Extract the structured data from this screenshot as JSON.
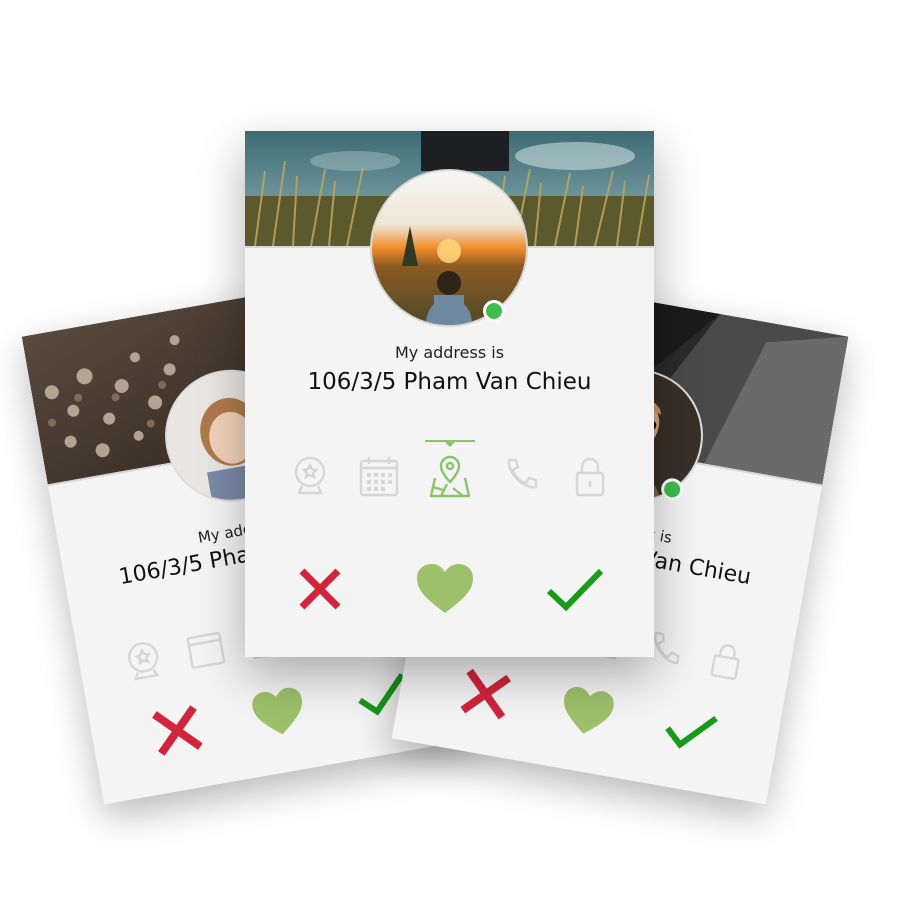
{
  "cards": {
    "left": {
      "subtitle": "My address is",
      "title": "106/3/5 Pham Van Chieu"
    },
    "right": {
      "subtitle": "My address is",
      "title": "106/3/5 Pham Van Chieu"
    },
    "center": {
      "subtitle": "My address is",
      "title": "106/3/5 Pham Van Chieu"
    }
  },
  "tabs": [
    "globe-icon",
    "calendar-icon",
    "map-icon",
    "phone-icon",
    "lock-icon"
  ],
  "active_tab": "map-icon",
  "actions": [
    "reject-button",
    "like-button",
    "accept-button"
  ],
  "colors": {
    "card_background": "#f4f4f4",
    "reject": "#d2243c",
    "like": "#9dc06b",
    "accept": "#1a9a1a",
    "online": "#3fbe4f",
    "active_tab": "#8cc36a",
    "inactive_tab": "#d6d6d6"
  }
}
